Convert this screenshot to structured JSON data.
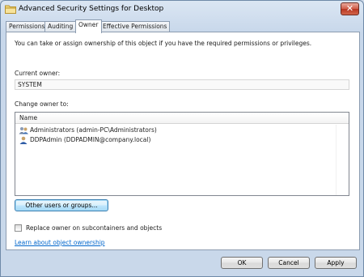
{
  "window": {
    "title": "Advanced Security Settings for Desktop",
    "close_glyph": "✕"
  },
  "tabs": [
    {
      "label": "Permissions"
    },
    {
      "label": "Auditing"
    },
    {
      "label": "Owner",
      "active": true
    },
    {
      "label": "Effective Permissions"
    }
  ],
  "owner_tab": {
    "intro": "You can take or assign ownership of this object if you have the required permissions or privileges.",
    "current_owner_label": "Current owner:",
    "current_owner_value": "SYSTEM",
    "change_owner_label": "Change owner to:",
    "list_header": "Name",
    "list_items": [
      {
        "label": "Administrators (admin-PC\\Administrators)",
        "icon": "group-icon"
      },
      {
        "label": "DDPAdmin (DDPADMIN@company.local)",
        "icon": "user-icon"
      }
    ],
    "other_users_button": "Other users or groups...",
    "replace_checkbox_label": "Replace owner on subcontainers and objects",
    "replace_checked": false,
    "learn_link": "Learn about object ownership"
  },
  "buttons": {
    "ok": "OK",
    "cancel": "Cancel",
    "apply": "Apply"
  },
  "colors": {
    "close_button": "#c9402c",
    "link": "#0066cc",
    "focus_border": "#3c7fb1"
  }
}
